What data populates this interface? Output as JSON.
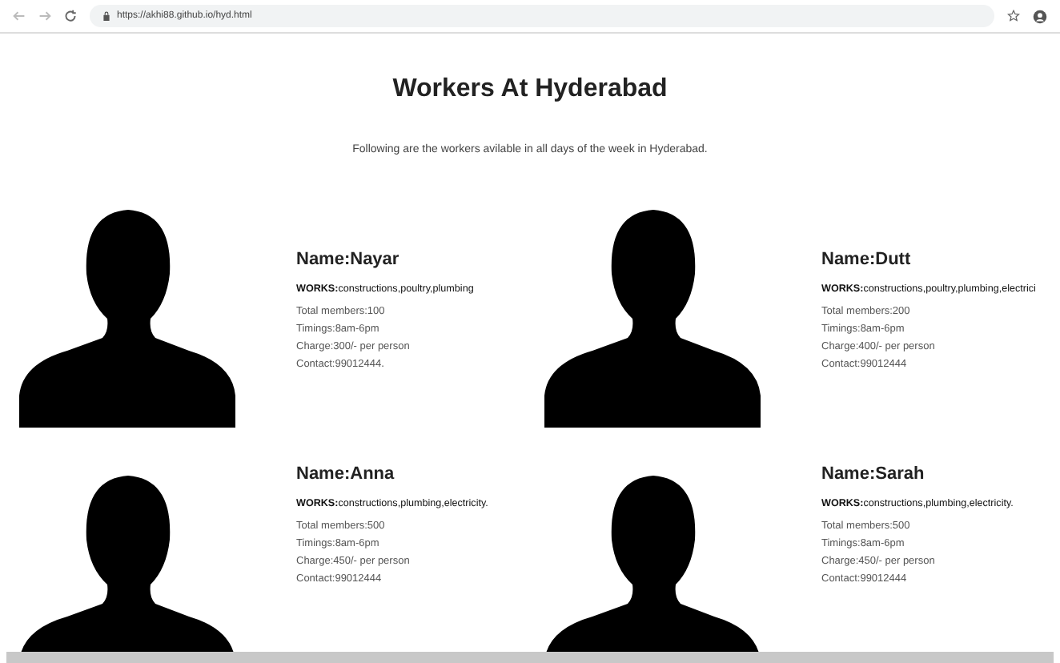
{
  "browser": {
    "url": "https://akhi88.github.io/hyd.html"
  },
  "page": {
    "title": "Workers At Hyderabad",
    "intro": "Following are the workers avilable in all days of the week in Hyderabad."
  },
  "workers": [
    {
      "name": "Name:Nayar",
      "works": "**WORKS:**constructions,poultry,plumbing",
      "details": [
        "Total members:100",
        "Timings:8am-6pm",
        "Charge:300/- per person",
        "Contact:99012444."
      ]
    },
    {
      "name": "Name:Dutt",
      "works": "**WORKS:**constructions,poultry,plumbing,electrici",
      "details": [
        "Total members:200",
        "Timings:8am-6pm",
        "Charge:400/- per person",
        "Contact:99012444"
      ]
    },
    {
      "name": "Name:Anna",
      "works": "**WORKS:**constructions,plumbing,electricity.",
      "details": [
        "Total members:500",
        "Timings:8am-6pm",
        "Charge:450/- per person",
        "Contact:99012444"
      ]
    },
    {
      "name": "Name:Sarah",
      "works": "**WORKS:**constructions,plumbing,electricity.",
      "details": [
        "Total members:500",
        "Timings:8am-6pm",
        "Charge:450/- per person",
        "Contact:99012444"
      ]
    }
  ]
}
